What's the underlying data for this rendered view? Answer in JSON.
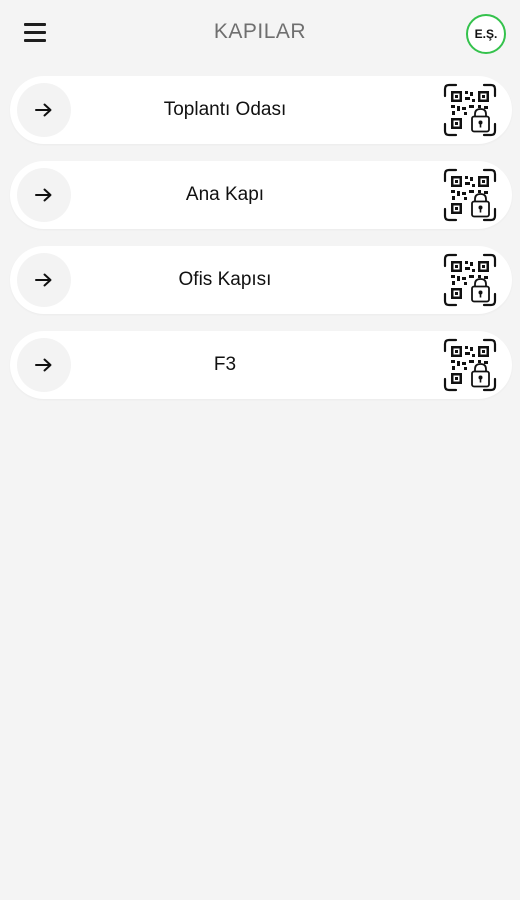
{
  "header": {
    "title": "KAPILAR",
    "menu_icon": "hamburger-menu-icon",
    "avatar_initials": "E.Ş.",
    "avatar_border_color": "#34c24c"
  },
  "doors": [
    {
      "name": "Toplantı Odası",
      "left_icon": "arrow-right-icon",
      "right_icon": "qr-lock-icon"
    },
    {
      "name": "Ana Kapı",
      "left_icon": "arrow-right-icon",
      "right_icon": "qr-lock-icon"
    },
    {
      "name": "Ofis Kapısı",
      "left_icon": "arrow-right-icon",
      "right_icon": "qr-lock-icon"
    },
    {
      "name": "F3",
      "left_icon": "arrow-right-icon",
      "right_icon": "qr-lock-icon"
    }
  ],
  "colors": {
    "background": "#f4f4f4",
    "card": "#ffffff",
    "title_text": "#6f6f6f"
  }
}
